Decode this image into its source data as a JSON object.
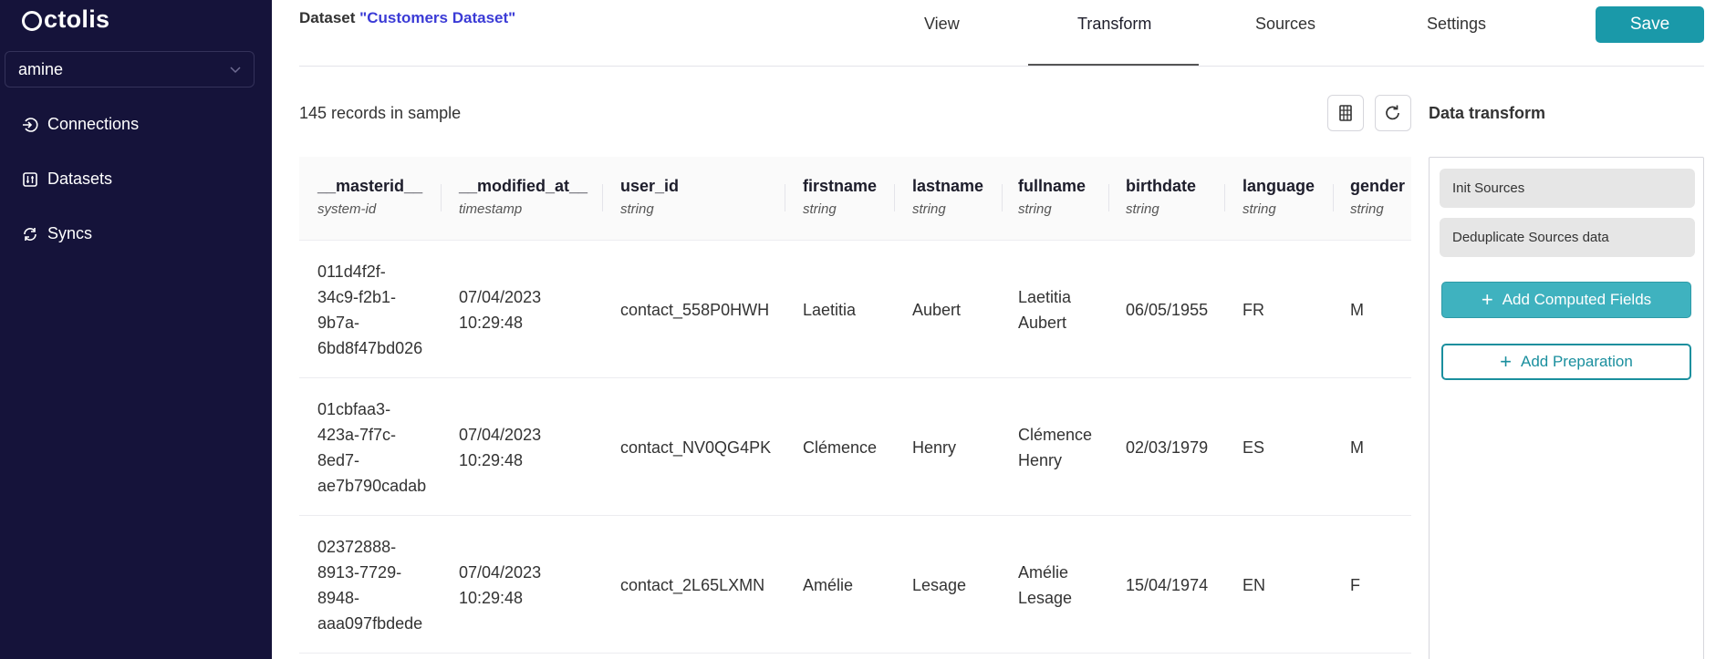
{
  "brand": {
    "name": "ctolis"
  },
  "org_select": {
    "value": "amine"
  },
  "sidebar": {
    "items": [
      {
        "label": "Connections"
      },
      {
        "label": "Datasets"
      },
      {
        "label": "Syncs"
      }
    ]
  },
  "header": {
    "title_prefix": "Dataset ",
    "dataset_name": "\"Customers Dataset\"",
    "tabs": [
      {
        "label": "View"
      },
      {
        "label": "Transform",
        "active": true
      },
      {
        "label": "Sources"
      },
      {
        "label": "Settings"
      }
    ],
    "save_label": "Save"
  },
  "toolbar": {
    "records_text": "145 records in sample",
    "columns_icon": "table-columns-icon",
    "refresh_icon": "refresh-icon"
  },
  "table": {
    "columns": [
      {
        "name": "__masterid__",
        "type": "system-id"
      },
      {
        "name": "__modified_at__",
        "type": "timestamp"
      },
      {
        "name": "user_id",
        "type": "string"
      },
      {
        "name": "firstname",
        "type": "string"
      },
      {
        "name": "lastname",
        "type": "string"
      },
      {
        "name": "fullname",
        "type": "string"
      },
      {
        "name": "birthdate",
        "type": "string"
      },
      {
        "name": "language",
        "type": "string"
      },
      {
        "name": "gender",
        "type": "string"
      }
    ],
    "rows": [
      {
        "masterid": [
          "011d4f2f-",
          "34c9-f2b1-",
          "9b7a-",
          "6bd8f47bd026"
        ],
        "modified": [
          "07/04/2023",
          "10:29:48"
        ],
        "user_id": "contact_558P0HWH",
        "firstname": "Laetitia",
        "lastname": "Aubert",
        "fullname": [
          "Laetitia",
          "Aubert"
        ],
        "birthdate": "06/05/1955",
        "language": "FR",
        "gender": "M"
      },
      {
        "masterid": [
          "01cbfaa3-",
          "423a-7f7c-",
          "8ed7-",
          "ae7b790cadab"
        ],
        "modified": [
          "07/04/2023",
          "10:29:48"
        ],
        "user_id": "contact_NV0QG4PK",
        "firstname": "Clémence",
        "lastname": "Henry",
        "fullname": [
          "Clémence",
          "Henry"
        ],
        "birthdate": "02/03/1979",
        "language": "ES",
        "gender": "M"
      },
      {
        "masterid": [
          "02372888-",
          "8913-7729-",
          "8948-",
          "aaa097fbdede"
        ],
        "modified": [
          "07/04/2023",
          "10:29:48"
        ],
        "user_id": "contact_2L65LXMN",
        "firstname": "Amélie",
        "lastname": "Lesage",
        "fullname": [
          "Amélie",
          "Lesage"
        ],
        "birthdate": "15/04/1974",
        "language": "EN",
        "gender": "F"
      }
    ]
  },
  "panel": {
    "title": "Data transform",
    "steps": [
      {
        "label": "Init Sources"
      },
      {
        "label": "Deduplicate Sources data"
      }
    ],
    "add_computed_label": "Add Computed Fields",
    "add_preparation_label": "Add Preparation"
  },
  "colors": {
    "sidebar_bg": "#15133a",
    "accent": "#1a99a9",
    "dataset_name": "#3b3bd6"
  }
}
